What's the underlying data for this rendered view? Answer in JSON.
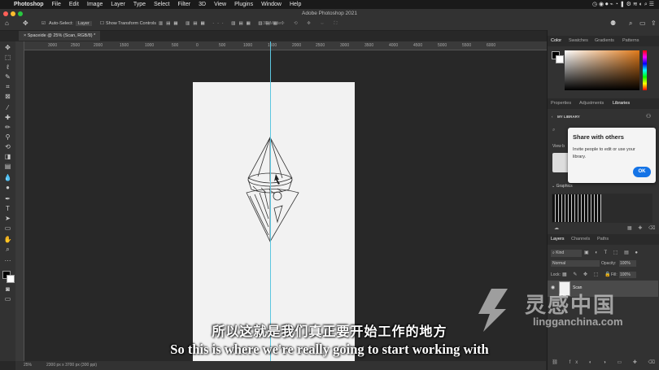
{
  "menubar": {
    "app": "Photoshop",
    "items": [
      "File",
      "Edit",
      "Image",
      "Layer",
      "Type",
      "Select",
      "Filter",
      "3D",
      "View",
      "Plugins",
      "Window",
      "Help"
    ]
  },
  "window": {
    "title": "Adobe Photoshop 2021"
  },
  "options": {
    "auto_select_label": "Auto-Select:",
    "auto_select_value": "Layer",
    "show_transform_label": "Show Transform Controls",
    "mode_3d": "3D Mode:"
  },
  "document": {
    "tab_title": "Spaceide @ 25% (Scan, RGB/8) *"
  },
  "ruler": {
    "ticks": [
      "3000",
      "2500",
      "2000",
      "1500",
      "1000",
      "500",
      "0",
      "500",
      "1000",
      "1500",
      "2000",
      "2500",
      "3000",
      "3500",
      "4000",
      "4500",
      "5000",
      "5500",
      "6000"
    ]
  },
  "status": {
    "zoom": "25%",
    "doc_size": "2300 px x 3700 px (300 ppi)"
  },
  "panels": {
    "color_tabs": [
      "Color",
      "Swatches",
      "Gradients",
      "Patterns"
    ],
    "lib_tabs": [
      "Properties",
      "Adjustments",
      "Libraries"
    ],
    "library_name": "MY LIBRARY",
    "view_by": "View b",
    "graphics_label": "Graphics",
    "layers_tabs": [
      "Layers",
      "Channels",
      "Paths"
    ],
    "kind": "Kind",
    "blend_mode": "Normal",
    "opacity_label": "Opacity:",
    "opacity_value": "100%",
    "lock_label": "Lock:",
    "fill_label": "Fill:",
    "fill_value": "100%",
    "layer_name": "Scan"
  },
  "popover": {
    "title": "Share with others",
    "message": "Invite people to edit or use your library.",
    "ok": "OK"
  },
  "subtitles": {
    "zh": "所以这就是我们真正要开始工作的地方",
    "en": "So this is where we're really going to start working with"
  },
  "watermark": {
    "brand": "灵感中国",
    "url": "lingganchina.com"
  },
  "colors": {
    "accent": "#1473e6",
    "guide": "#5cc6e0",
    "foreground": "#000000",
    "background": "#ffffff"
  }
}
